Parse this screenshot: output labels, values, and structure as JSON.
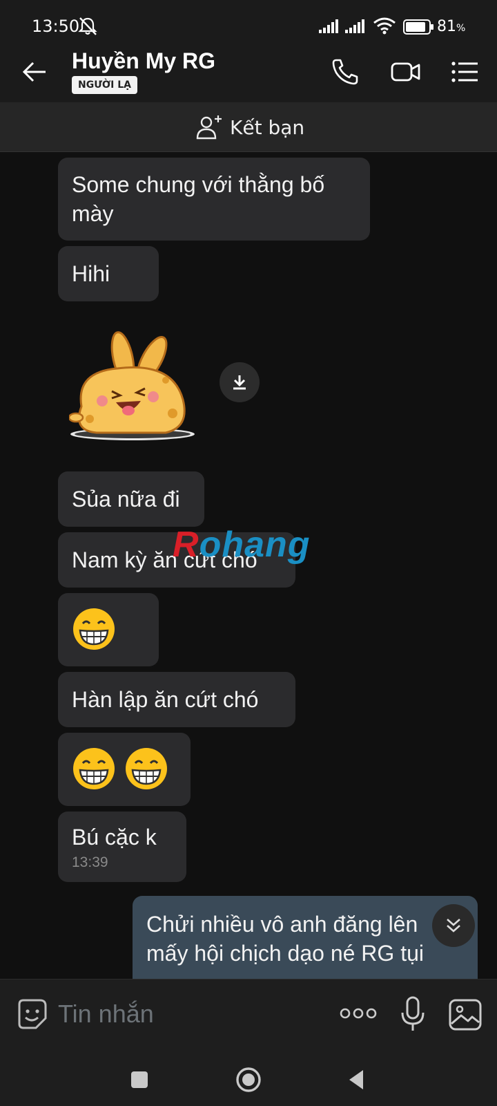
{
  "status_bar": {
    "time": "13:50",
    "battery_percent": "81",
    "battery_symbol": "%",
    "icons": [
      "mute-bell-icon",
      "signal-icon",
      "signal-icon",
      "wifi-icon",
      "battery-icon"
    ]
  },
  "header": {
    "back_icon": "back-arrow-icon",
    "contact_name": "Huyền My RG",
    "badge": "NGƯỜI LẠ",
    "actions": [
      "phone-icon",
      "video-call-icon",
      "menu-list-icon"
    ]
  },
  "add_friend": {
    "label": "Kết bạn",
    "icon": "add-person-icon"
  },
  "messages": [
    {
      "sender": "contact",
      "type": "text",
      "line1": "Some chung với thằng bố",
      "line2": "mày"
    },
    {
      "sender": "contact",
      "type": "text",
      "text": "Hihi"
    },
    {
      "sender": "contact",
      "type": "sticker",
      "sticker": "bunny-laughing-sticker",
      "action_icon": "download-icon"
    },
    {
      "sender": "contact",
      "type": "text",
      "text": "Sủa nữa đi"
    },
    {
      "sender": "contact",
      "type": "text",
      "text": "Nam kỳ ăn cứt chó"
    },
    {
      "sender": "contact",
      "type": "emoji",
      "emoji": [
        "grinning-face-emoji"
      ]
    },
    {
      "sender": "contact",
      "type": "text",
      "text": "Hàn lập ăn cứt chó"
    },
    {
      "sender": "contact",
      "type": "emoji",
      "emoji": [
        "grinning-face-emoji",
        "grinning-face-emoji"
      ]
    },
    {
      "sender": "contact",
      "type": "text",
      "text": "Bú cặc k",
      "timestamp": "13:39"
    },
    {
      "sender": "me",
      "type": "text",
      "line1": "Chửi nhiều vô anh đăng lên",
      "line2": "mấy hội chịch dạo né RG tụi"
    }
  ],
  "watermark": {
    "part1": "R",
    "part2": "ohang"
  },
  "scroll_down_icon": "double-chevron-down-icon",
  "input_bar": {
    "placeholder": "Tin nhắn",
    "icons": [
      "sticker-smile-icon",
      "more-dots-icon",
      "microphone-icon",
      "image-icon"
    ]
  },
  "nav_bar": {
    "icons": [
      "recents-square-icon",
      "home-circle-icon",
      "back-triangle-icon"
    ]
  },
  "colors": {
    "background": "#101010",
    "bubble_incoming": "#2b2b2d",
    "bubble_outgoing": "#3a4a58",
    "watermark_red": "#d91f28",
    "watermark_blue": "#1a8fc4"
  }
}
